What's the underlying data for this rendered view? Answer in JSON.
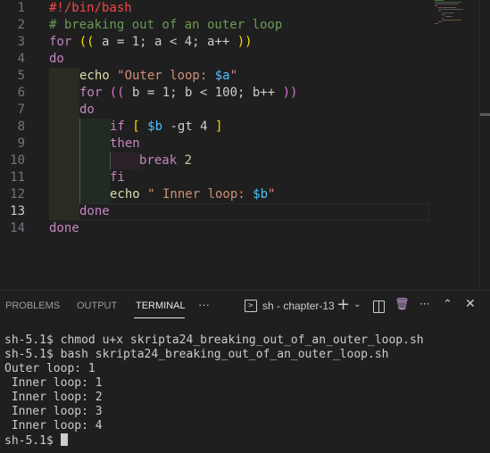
{
  "editor": {
    "line_numbers": [
      "1",
      "2",
      "3",
      "4",
      "5",
      "6",
      "7",
      "8",
      "9",
      "10",
      "11",
      "12",
      "13",
      "14"
    ],
    "current_line": "13",
    "lines": {
      "l1": "#!/bin/bash",
      "l2": "# breaking out of an outer loop",
      "l3_kw": "for",
      "l3_a": "((",
      "l3_b": " a = 1; a < 4; a++ ",
      "l3_c": "))",
      "l4": "do",
      "l5_fn": "echo",
      "l5_s": " \"Outer loop: ",
      "l5_v": "$a",
      "l5_e": "\"",
      "l6_kw": "for",
      "l6_a": "((",
      "l6_b": " b = 1; b < 100; b++ ",
      "l6_c": "))",
      "l7": "do",
      "l8_kw": "if",
      "l8_a": "[",
      "l8_v": "$b",
      "l8_b": " -gt 4 ",
      "l8_c": "]",
      "l9": "then",
      "l10_kw": "break",
      "l10_n": "2",
      "l11": "fi",
      "l12_fn": "echo",
      "l12_s": " \" Inner loop: ",
      "l12_v": "$b",
      "l12_e": "\"",
      "l13": "done",
      "l14": "done"
    }
  },
  "panel": {
    "tabs": [
      "PROBLEMS",
      "OUTPUT",
      "TERMINAL"
    ],
    "active_tab": "TERMINAL",
    "more": "···",
    "terminal_name": "sh - chapter-13",
    "icons": [
      "terminal-icon",
      "plus-icon",
      "chevron-down-icon",
      "split-icon",
      "trash-icon",
      "more-icon",
      "chevron-up-icon",
      "close-icon"
    ]
  },
  "terminal": {
    "lines": [
      "sh-5.1$ chmod u+x skripta24_breaking_out_of_an_outer_loop.sh",
      "sh-5.1$ bash skripta24_breaking_out_of_an_outer_loop.sh",
      "Outer loop: 1",
      " Inner loop: 1",
      " Inner loop: 2",
      " Inner loop: 3",
      " Inner loop: 4"
    ],
    "prompt": "sh-5.1$ "
  }
}
